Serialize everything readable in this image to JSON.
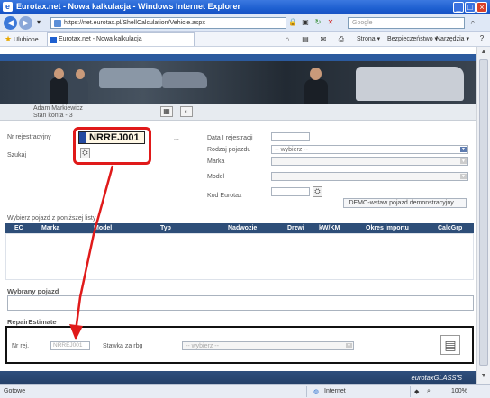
{
  "window": {
    "title": "Eurotax.net - Nowa kalkulacja - Windows Internet Explorer"
  },
  "address_bar": {
    "url": "https://net.eurotax.pl/ShellCalculation/Vehicle.aspx",
    "search_placeholder": "Google"
  },
  "favorites": {
    "label": "Ulubione",
    "tab_title": "Eurotax.net - Nowa kalkulacja"
  },
  "commands": {
    "page": "Strona",
    "safety": "Bezpieczeństwo",
    "tools": "Narzędzia"
  },
  "user": {
    "name": "Adam Markiewicz",
    "balance": "Stan konta - 3"
  },
  "form": {
    "reg_label": "Nr rejestracyjny",
    "reg_value": "NRREJ001",
    "search_label": "Szukaj",
    "dots": "...",
    "date_label": "Data I rejestracji",
    "type_label": "Rodzaj pojazdu",
    "type_value": "-- wybierz --",
    "make_label": "Marka",
    "model_label": "Model",
    "code_label": "Kod Eurotax",
    "demo_button": "DEMO-wstaw pojazd demonstracyjny ..."
  },
  "vehicle_list": {
    "hint": "Wybierz pojazd z poniższej listy",
    "columns": [
      "EC",
      "Marka",
      "Model",
      "Typ",
      "Nadwozie",
      "Drzwi",
      "kW/KM",
      "Okres importu",
      "CalcGrp"
    ]
  },
  "selected_vehicle": {
    "title": "Wybrany pojazd"
  },
  "repair_estimate": {
    "title": "RepairEstimate",
    "reg_label": "Nr rej.",
    "reg_value": "NRREJ001",
    "rate_label": "Stawka za rbg",
    "rate_value": "-- wybierz --"
  },
  "footer": {
    "brand": "eurotaxGLASS'S"
  },
  "status": {
    "left": "Gotowe",
    "zone": "Internet",
    "zoom": "100%"
  }
}
